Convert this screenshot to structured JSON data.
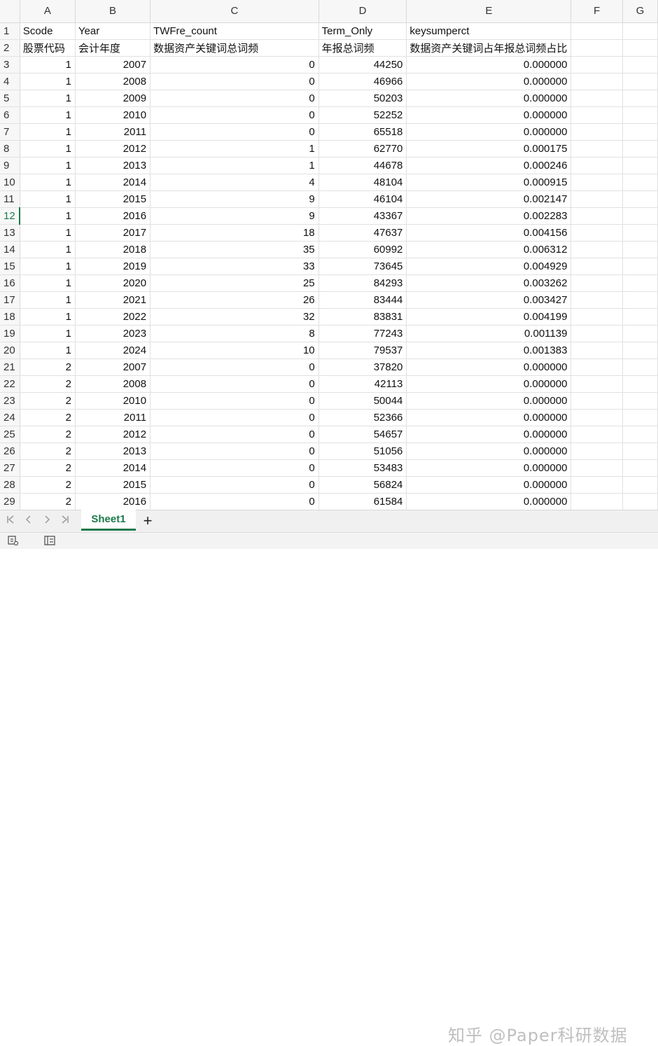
{
  "columns": [
    "A",
    "B",
    "C",
    "D",
    "E",
    "F",
    "G"
  ],
  "header_row": {
    "num": "1",
    "cells": [
      "Scode",
      "Year",
      "TWFre_count",
      "Term_Only",
      "keysumperct",
      ""
    ]
  },
  "label_row": {
    "num": "2",
    "cells": [
      "股票代码",
      "会计年度",
      "数据资产关键词总词频",
      "年报总词频",
      "数据资产关键词占年报总词频占比",
      ""
    ]
  },
  "data_rows": [
    {
      "num": "3",
      "cells": [
        "1",
        "2007",
        "0",
        "44250",
        "0.000000",
        ""
      ]
    },
    {
      "num": "4",
      "cells": [
        "1",
        "2008",
        "0",
        "46966",
        "0.000000",
        ""
      ]
    },
    {
      "num": "5",
      "cells": [
        "1",
        "2009",
        "0",
        "50203",
        "0.000000",
        ""
      ]
    },
    {
      "num": "6",
      "cells": [
        "1",
        "2010",
        "0",
        "52252",
        "0.000000",
        ""
      ]
    },
    {
      "num": "7",
      "cells": [
        "1",
        "2011",
        "0",
        "65518",
        "0.000000",
        ""
      ]
    },
    {
      "num": "8",
      "cells": [
        "1",
        "2012",
        "1",
        "62770",
        "0.000175",
        ""
      ]
    },
    {
      "num": "9",
      "cells": [
        "1",
        "2013",
        "1",
        "44678",
        "0.000246",
        ""
      ]
    },
    {
      "num": "10",
      "cells": [
        "1",
        "2014",
        "4",
        "48104",
        "0.000915",
        ""
      ]
    },
    {
      "num": "11",
      "cells": [
        "1",
        "2015",
        "9",
        "46104",
        "0.002147",
        ""
      ]
    },
    {
      "num": "12",
      "cells": [
        "1",
        "2016",
        "9",
        "43367",
        "0.002283",
        ""
      ]
    },
    {
      "num": "13",
      "cells": [
        "1",
        "2017",
        "18",
        "47637",
        "0.004156",
        ""
      ]
    },
    {
      "num": "14",
      "cells": [
        "1",
        "2018",
        "35",
        "60992",
        "0.006312",
        ""
      ]
    },
    {
      "num": "15",
      "cells": [
        "1",
        "2019",
        "33",
        "73645",
        "0.004929",
        ""
      ]
    },
    {
      "num": "16",
      "cells": [
        "1",
        "2020",
        "25",
        "84293",
        "0.003262",
        ""
      ]
    },
    {
      "num": "17",
      "cells": [
        "1",
        "2021",
        "26",
        "83444",
        "0.003427",
        ""
      ]
    },
    {
      "num": "18",
      "cells": [
        "1",
        "2022",
        "32",
        "83831",
        "0.004199",
        ""
      ]
    },
    {
      "num": "19",
      "cells": [
        "1",
        "2023",
        "8",
        "77243",
        "0.001139",
        ""
      ]
    },
    {
      "num": "20",
      "cells": [
        "1",
        "2024",
        "10",
        "79537",
        "0.001383",
        ""
      ]
    },
    {
      "num": "21",
      "cells": [
        "2",
        "2007",
        "0",
        "37820",
        "0.000000",
        ""
      ]
    },
    {
      "num": "22",
      "cells": [
        "2",
        "2008",
        "0",
        "42113",
        "0.000000",
        ""
      ]
    },
    {
      "num": "23",
      "cells": [
        "2",
        "2010",
        "0",
        "50044",
        "0.000000",
        ""
      ]
    },
    {
      "num": "24",
      "cells": [
        "2",
        "2011",
        "0",
        "52366",
        "0.000000",
        ""
      ]
    },
    {
      "num": "25",
      "cells": [
        "2",
        "2012",
        "0",
        "54657",
        "0.000000",
        ""
      ]
    },
    {
      "num": "26",
      "cells": [
        "2",
        "2013",
        "0",
        "51056",
        "0.000000",
        ""
      ]
    },
    {
      "num": "27",
      "cells": [
        "2",
        "2014",
        "0",
        "53483",
        "0.000000",
        ""
      ]
    },
    {
      "num": "28",
      "cells": [
        "2",
        "2015",
        "0",
        "56824",
        "0.000000",
        ""
      ]
    },
    {
      "num": "29",
      "cells": [
        "2",
        "2016",
        "0",
        "61584",
        "0.000000",
        ""
      ]
    }
  ],
  "active_row": "12",
  "sheet_tabs": [
    "Sheet1"
  ],
  "add_sheet_label": "+",
  "watermark": "知乎 @Paper科研数据",
  "nav_icons": [
    "first-sheet-icon",
    "prev-sheet-icon",
    "next-sheet-icon",
    "last-sheet-icon"
  ],
  "status_icons": [
    "macro-record-icon",
    "page-layout-icon"
  ],
  "colors": {
    "accent": "#1a7a4a",
    "header_bg": "#f7f7f7",
    "grid_line": "#e1e1e1"
  }
}
